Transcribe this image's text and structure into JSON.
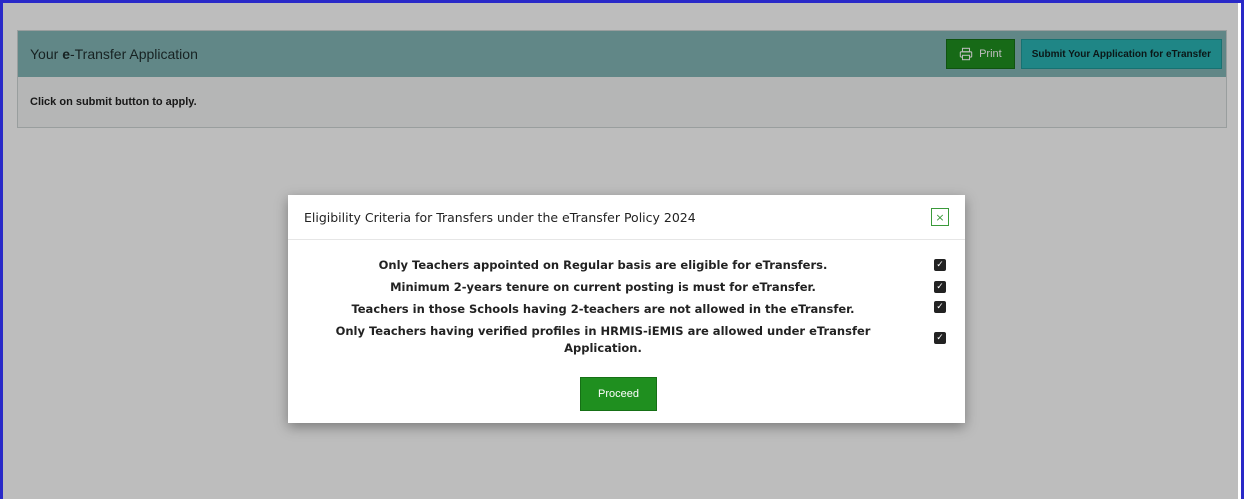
{
  "header": {
    "title_prefix": "Your ",
    "title_bold": "e",
    "title_suffix": "-Transfer Application",
    "print_label": "Print",
    "submit_label": "Submit Your Application for eTransfer"
  },
  "body": {
    "instruction": "Click on submit button to apply."
  },
  "modal": {
    "title": "Eligibility Criteria for Transfers under the eTransfer Policy 2024",
    "close_symbol": "×",
    "criteria": [
      {
        "text": "Only Teachers appointed on Regular basis are eligible for eTransfers.",
        "checked": true
      },
      {
        "text": "Minimum 2-years tenure on current posting is must for eTransfer.",
        "checked": true
      },
      {
        "text": "Teachers in those Schools having 2-teachers are not allowed in the eTransfer.",
        "checked": true
      },
      {
        "text": "Only Teachers having verified profiles in HRMIS-iEMIS are allowed under eTransfer Application.",
        "checked": true
      }
    ],
    "proceed_label": "Proceed"
  },
  "colors": {
    "frame_border": "#2929c8",
    "header_bg": "#84b6b6",
    "print_btn": "#1f8f1f",
    "submit_btn": "#2ab5b5",
    "proceed_btn": "#1f8f1f"
  },
  "icons": {
    "print": "printer-icon",
    "close": "close-icon",
    "check": "checkbox-checked-icon"
  }
}
